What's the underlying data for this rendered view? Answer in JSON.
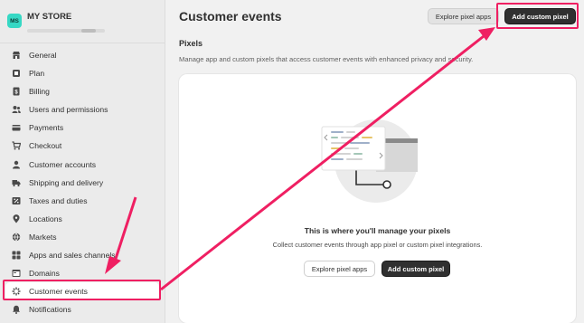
{
  "store": {
    "initials": "MS",
    "name": "MY STORE"
  },
  "nav": [
    {
      "label": "General",
      "icon": "store-icon"
    },
    {
      "label": "Plan",
      "icon": "plan-icon"
    },
    {
      "label": "Billing",
      "icon": "billing-icon"
    },
    {
      "label": "Users and permissions",
      "icon": "users-icon"
    },
    {
      "label": "Payments",
      "icon": "payments-icon"
    },
    {
      "label": "Checkout",
      "icon": "cart-icon"
    },
    {
      "label": "Customer accounts",
      "icon": "person-icon"
    },
    {
      "label": "Shipping and delivery",
      "icon": "truck-icon"
    },
    {
      "label": "Taxes and duties",
      "icon": "taxes-icon"
    },
    {
      "label": "Locations",
      "icon": "location-icon"
    },
    {
      "label": "Markets",
      "icon": "globe-icon"
    },
    {
      "label": "Apps and sales channels",
      "icon": "apps-icon"
    },
    {
      "label": "Domains",
      "icon": "domains-icon"
    },
    {
      "label": "Customer events",
      "icon": "customer-events-icon",
      "active": true
    },
    {
      "label": "Notifications",
      "icon": "bell-icon"
    }
  ],
  "header": {
    "title": "Customer events",
    "explore_label": "Explore pixel apps",
    "add_label": "Add custom pixel"
  },
  "pixels": {
    "title": "Pixels",
    "description": "Manage app and custom pixels that access customer events with enhanced privacy and security."
  },
  "empty_state": {
    "title": "This is where you'll manage your pixels",
    "description": "Collect customer events through app pixel or custom pixel integrations.",
    "explore_label": "Explore pixel apps",
    "add_label": "Add custom pixel"
  },
  "colors": {
    "annotation": "#ef1f62",
    "primary_button": "#303030",
    "avatar": "#36d8c4"
  }
}
